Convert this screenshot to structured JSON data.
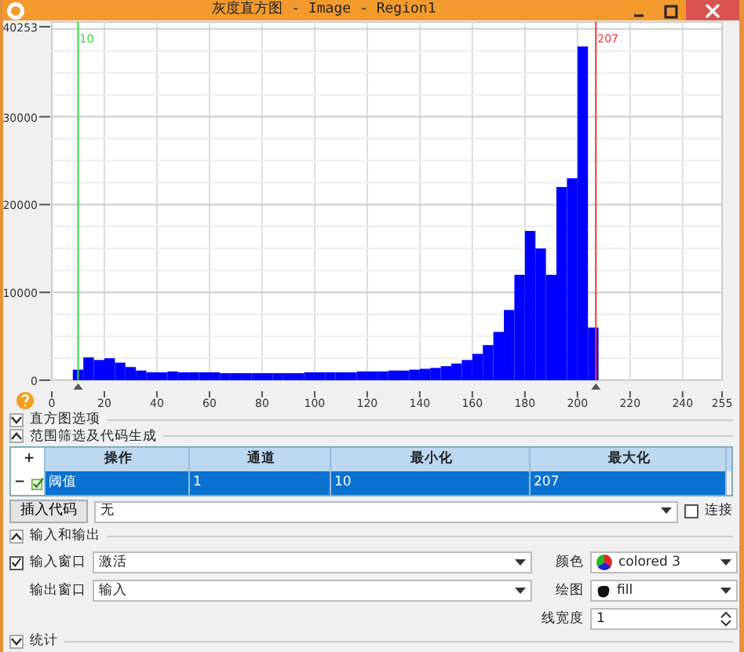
{
  "window": {
    "title": "灰度直方图 - Image - Region1"
  },
  "histogram": {
    "chart_data": {
      "type": "bar",
      "x": [
        10,
        14,
        18,
        22,
        26,
        30,
        34,
        38,
        42,
        46,
        50,
        54,
        58,
        62,
        66,
        70,
        74,
        78,
        82,
        86,
        90,
        94,
        98,
        102,
        106,
        110,
        114,
        118,
        122,
        126,
        130,
        134,
        138,
        142,
        146,
        150,
        154,
        158,
        162,
        166,
        170,
        174,
        178,
        182,
        186,
        190,
        194,
        198,
        202,
        206
      ],
      "series": [
        {
          "color": "#0000ff",
          "values": [
            1200,
            2600,
            2300,
            2500,
            2000,
            1500,
            1100,
            900,
            900,
            1000,
            900,
            900,
            900,
            900,
            800,
            800,
            800,
            800,
            800,
            800,
            800,
            800,
            900,
            900,
            900,
            900,
            900,
            1000,
            1000,
            1000,
            1100,
            1100,
            1200,
            1300,
            1400,
            1600,
            1900,
            2300,
            3000,
            4000,
            5500,
            8000,
            12000,
            17000,
            15000,
            12000,
            22000,
            23000,
            38000,
            6000
          ]
        }
      ],
      "grid": true,
      "xlim": [
        0,
        255
      ],
      "ylim": [
        0,
        40253
      ],
      "xticks": [
        0,
        20,
        40,
        60,
        80,
        100,
        120,
        140,
        160,
        180,
        200,
        220,
        240,
        255
      ],
      "yticks": [
        0,
        10000,
        20000,
        30000,
        40253
      ],
      "ref_lines": [
        {
          "axis": "x",
          "value": 10,
          "label": "10",
          "color": "#33dd33"
        },
        {
          "axis": "x",
          "value": 207,
          "label": "207",
          "color": "#ff3333"
        }
      ]
    }
  },
  "sections": [
    {
      "label": "直方图选项",
      "expanded": false
    },
    {
      "label": "范围筛选及代码生成",
      "expanded": true
    }
  ],
  "table": {
    "add": "+",
    "columns": [
      "操作",
      "通道",
      "最小化",
      "最大化"
    ],
    "rows": [
      {
        "remove": "−",
        "checked": true,
        "selected": true,
        "cells": [
          "阈值",
          "1",
          "10",
          "207"
        ]
      }
    ]
  },
  "insert_button": "插入代码",
  "code_combo": "无",
  "connect": {
    "label": "连接",
    "checked": false
  },
  "io_section": {
    "label": "输入和输出",
    "expanded": true
  },
  "input_window": {
    "label": "输入窗口",
    "checked": true,
    "value": "激活"
  },
  "output_window": {
    "label": "输出窗口",
    "value": "输入"
  },
  "color": {
    "label": "颜色",
    "value": "colored 3"
  },
  "draw": {
    "label": "绘图",
    "value": "fill"
  },
  "line_width": {
    "label": "线宽度",
    "value": "1"
  },
  "stats_section": {
    "label": "统计",
    "expanded": false
  }
}
